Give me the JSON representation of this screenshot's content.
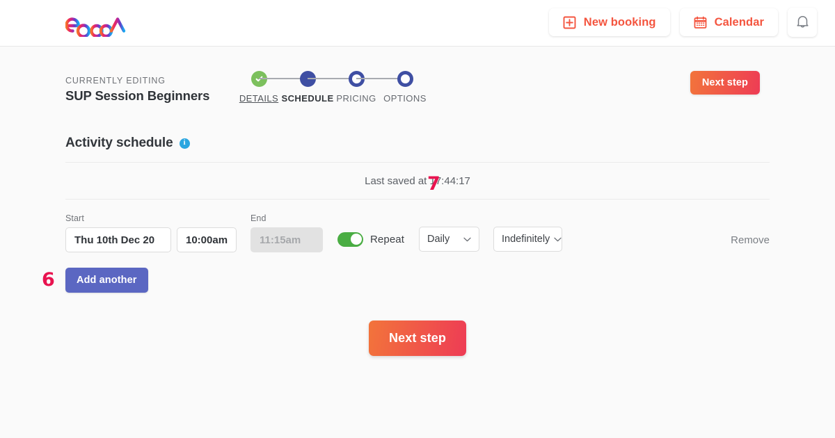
{
  "header": {
    "logo_text": "eola",
    "buttons": [
      {
        "label": "New booking",
        "icon": "plus-square-icon"
      },
      {
        "label": "Calendar",
        "icon": "calendar-icon"
      }
    ],
    "notifications_icon": "bell-icon",
    "accent_color": "#f4553f"
  },
  "stepbar": {
    "editing_label": "CURRENTLY EDITING",
    "editing_title": "SUP Session Beginners",
    "steps": [
      {
        "label": "DETAILS",
        "state": "done"
      },
      {
        "label": "SCHEDULE",
        "state": "active"
      },
      {
        "label": "PRICING",
        "state": "todo"
      },
      {
        "label": "OPTIONS",
        "state": "todo"
      }
    ],
    "next_step_label": "Next step",
    "done_color": "#7cc05d",
    "step_color": "#3f4fa3"
  },
  "main": {
    "section_title": "Activity schedule",
    "info_icon": "info-icon",
    "last_saved": "Last saved at 17:44:17",
    "schedule": {
      "start_label": "Start",
      "end_label": "End",
      "start_date": "Thu 10th Dec 20",
      "start_time": "10:00am",
      "end_time": "11:15am",
      "repeat_label": "Repeat",
      "repeat_enabled": true,
      "frequency": "Daily",
      "duration": "Indefinitely",
      "remove_label": "Remove"
    },
    "add_another_label": "Add another",
    "next_step_label": "Next step",
    "add_another_color": "#5b67c2",
    "toggle_on_color": "#4aad43"
  },
  "annotations": {
    "marker_add_another": "6",
    "marker_repeat": "7",
    "color": "#e8134f"
  }
}
